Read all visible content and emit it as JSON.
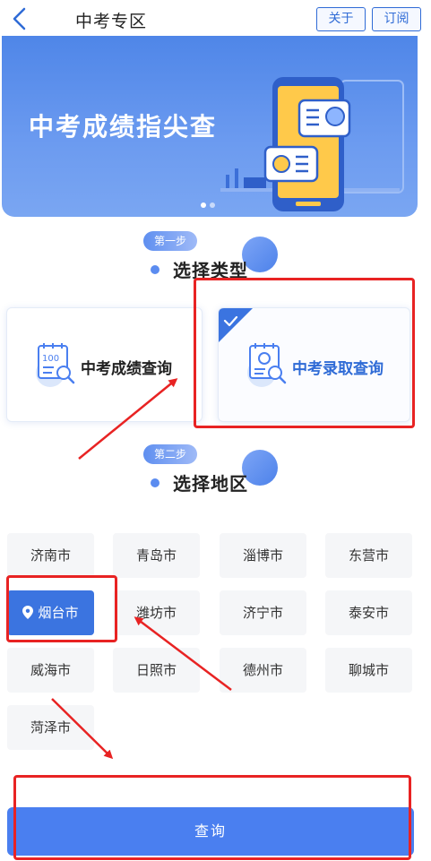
{
  "header": {
    "title": "中考专区",
    "about_label": "关于",
    "subscribe_label": "订阅"
  },
  "banner": {
    "headline": "中考成绩指尖查",
    "slides_total": 2,
    "active_slide": 1
  },
  "step1": {
    "badge": "第一步",
    "title": "选择类型",
    "options": [
      {
        "label": "中考成绩查询",
        "icon": "score-report-icon",
        "selected": false
      },
      {
        "label": "中考录取查询",
        "icon": "admission-report-icon",
        "selected": true
      }
    ]
  },
  "step2": {
    "badge": "第二步",
    "title": "选择地区",
    "cities": [
      "济南市",
      "青岛市",
      "淄博市",
      "东营市",
      "烟台市",
      "潍坊市",
      "济宁市",
      "泰安市",
      "威海市",
      "日照市",
      "德州市",
      "聊城市",
      "菏泽市"
    ],
    "selected_city": "烟台市"
  },
  "submit": {
    "label": "查询"
  },
  "colors": {
    "accent": "#3b74e0",
    "annotation": "#e82323"
  }
}
